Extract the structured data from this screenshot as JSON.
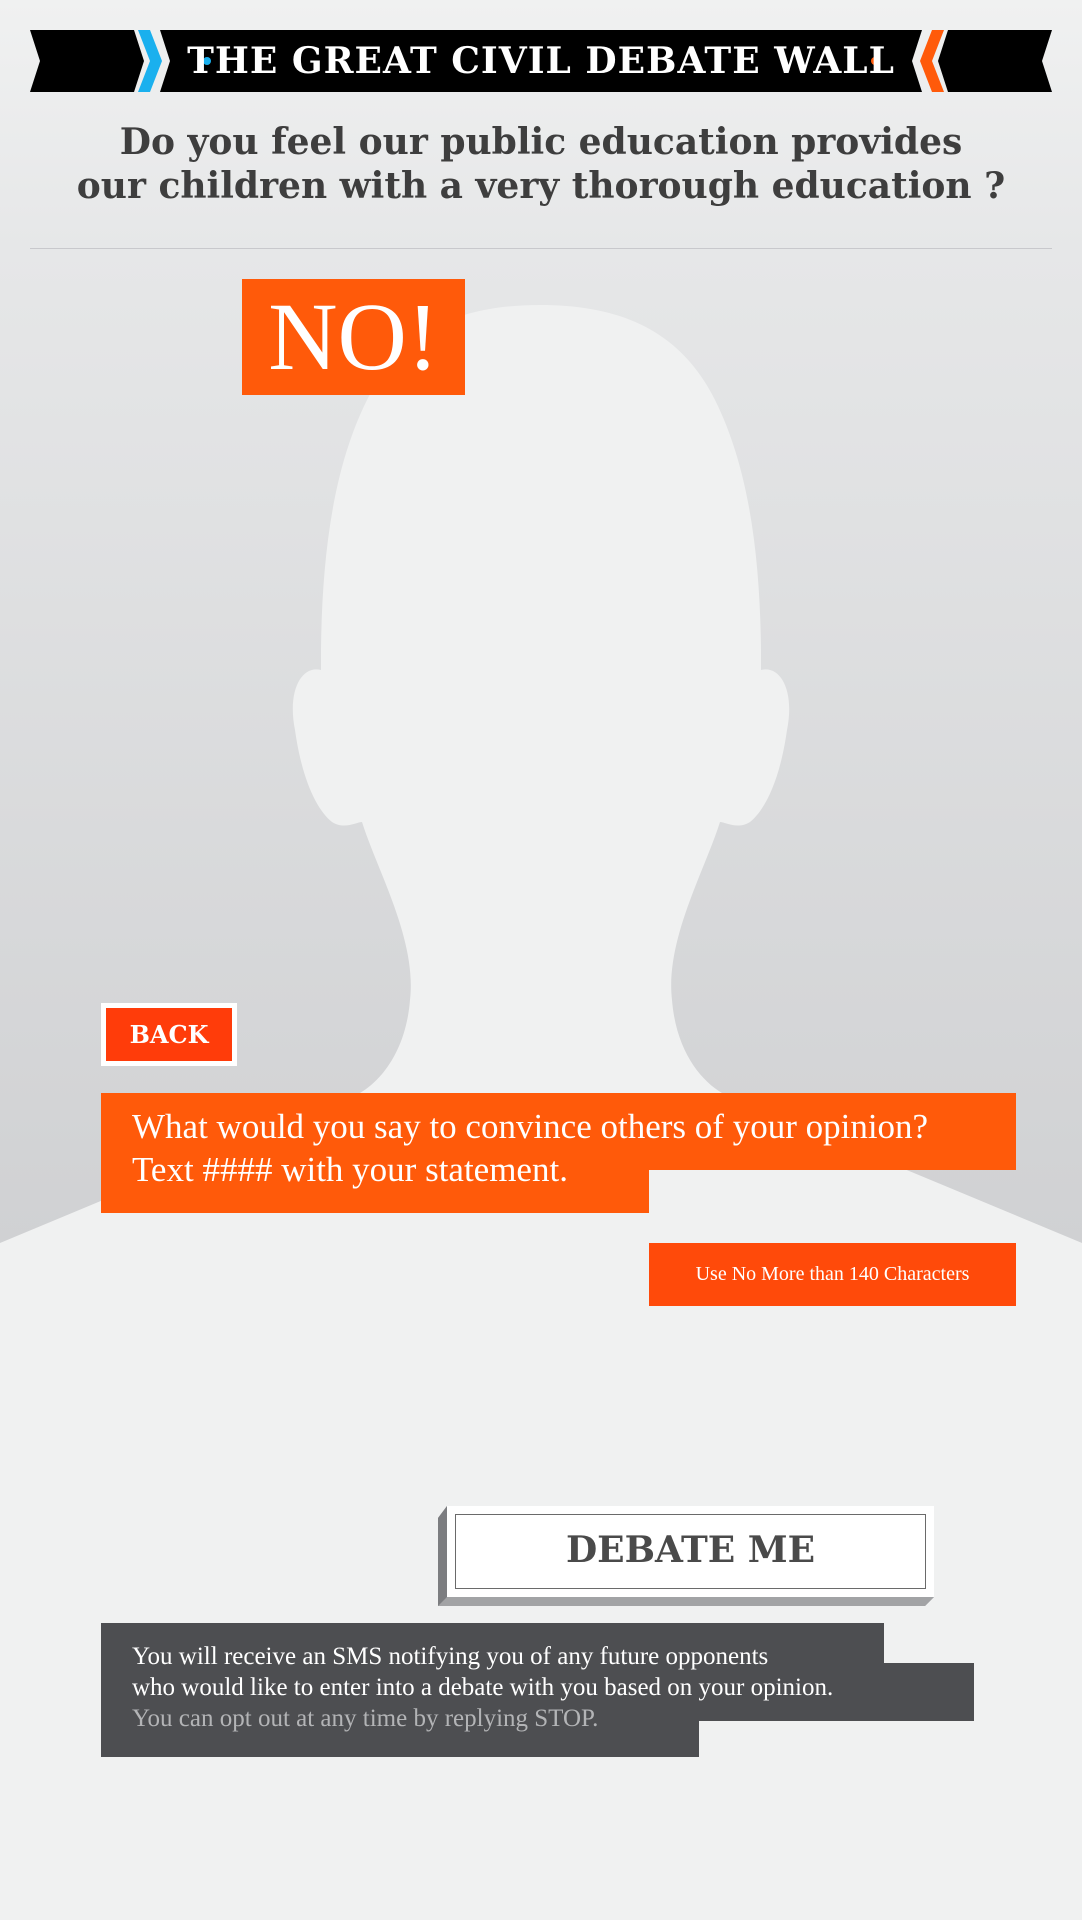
{
  "header": {
    "title": "THE GREAT CIVIL DEBATE WALL",
    "accent_left": "#1ab0ee",
    "accent_right": "#ff5a0a"
  },
  "question": {
    "line1": "Do you feel our public education provides",
    "line2": "our children with a very thorough education ?"
  },
  "stance": {
    "label": "NO!"
  },
  "back_button": {
    "label": "BACK"
  },
  "prompt": {
    "line1": "What would you say to convince others of your opinion?",
    "line2": "Text #### with your statement."
  },
  "char_limit": {
    "label": "Use No More than 140 Characters"
  },
  "debate_button": {
    "label": "DEBATE ME"
  },
  "info": {
    "line1": "You will receive an SMS notifying you of any future opponents",
    "line2": "who would like to enter into a debate with you based on your opinion.",
    "line3": "You can opt out at any time by replying STOP."
  },
  "colors": {
    "orange": "#ff5a0a",
    "dark_gray": "#4d4e51",
    "text_gray": "#3e3e3e",
    "background": "#f0f1f1"
  },
  "icons": [
    "chevron-right-icon",
    "chevron-left-icon",
    "dot-icon",
    "person-silhouette-icon"
  ]
}
